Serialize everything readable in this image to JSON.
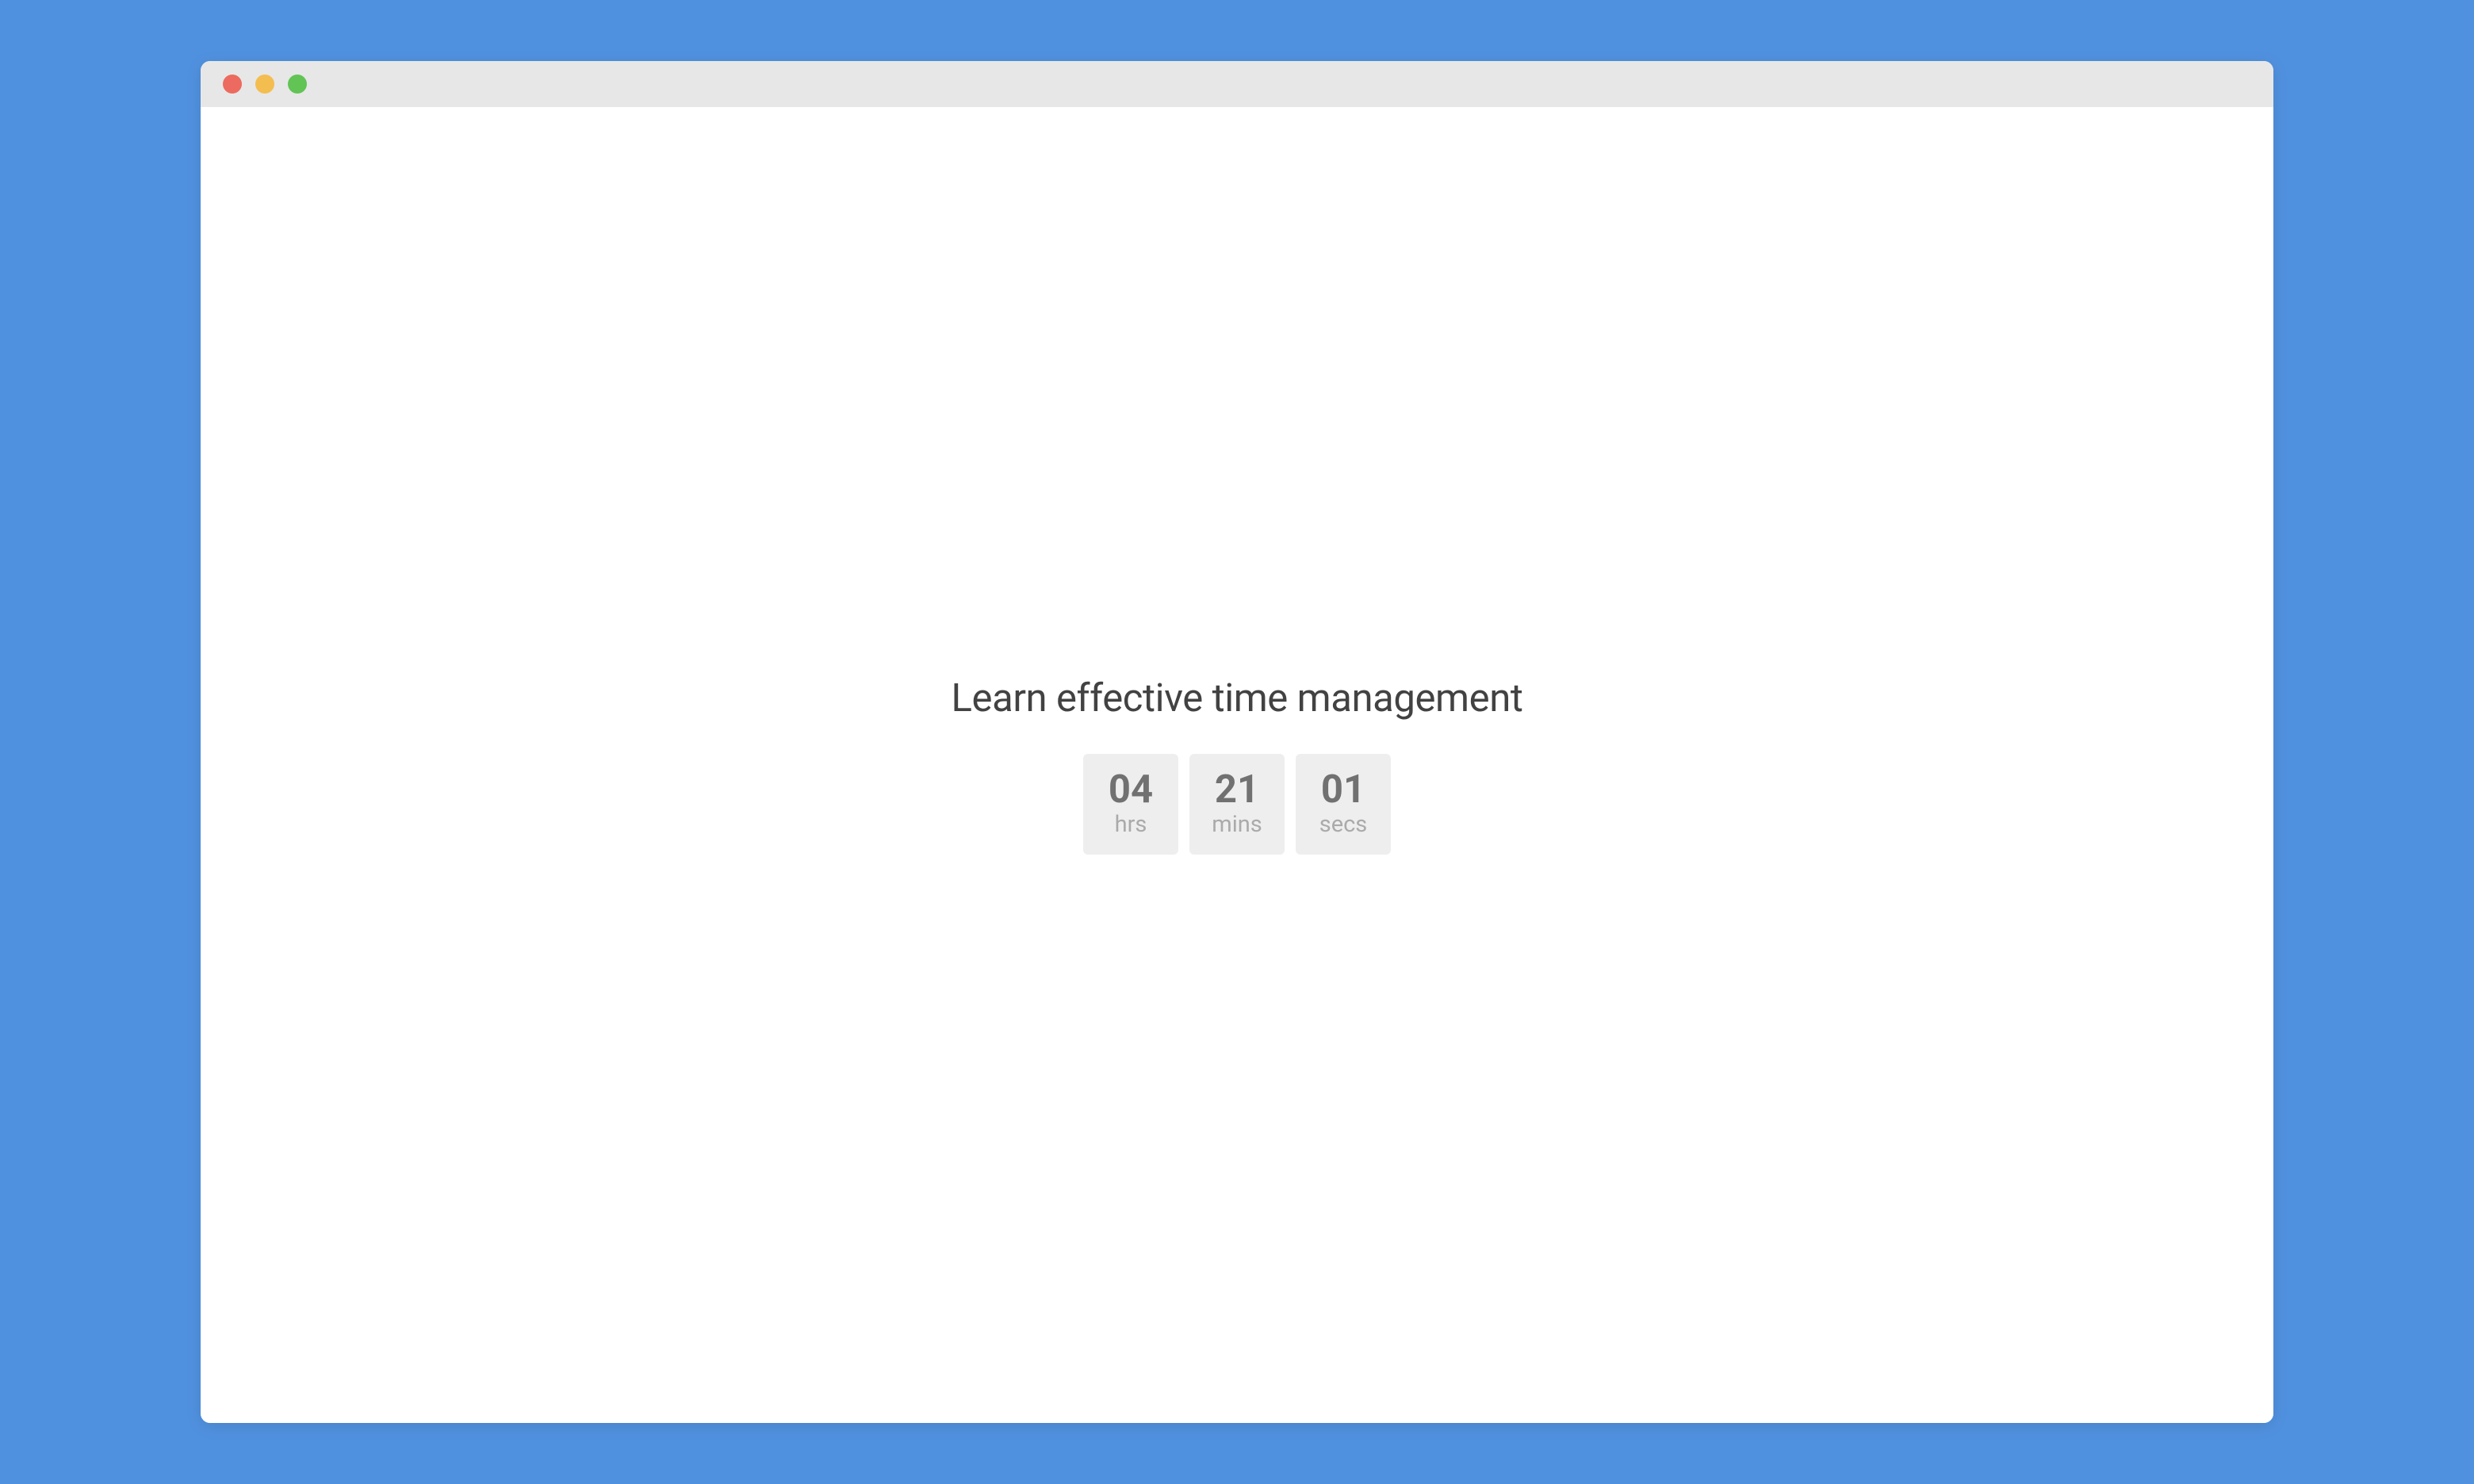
{
  "window": {
    "controls": {
      "close": "close",
      "minimize": "minimize",
      "maximize": "maximize"
    }
  },
  "page": {
    "heading": "Learn effective time management",
    "countdown": [
      {
        "value": "04",
        "label": "hrs"
      },
      {
        "value": "21",
        "label": "mins"
      },
      {
        "value": "01",
        "label": "secs"
      }
    ]
  }
}
